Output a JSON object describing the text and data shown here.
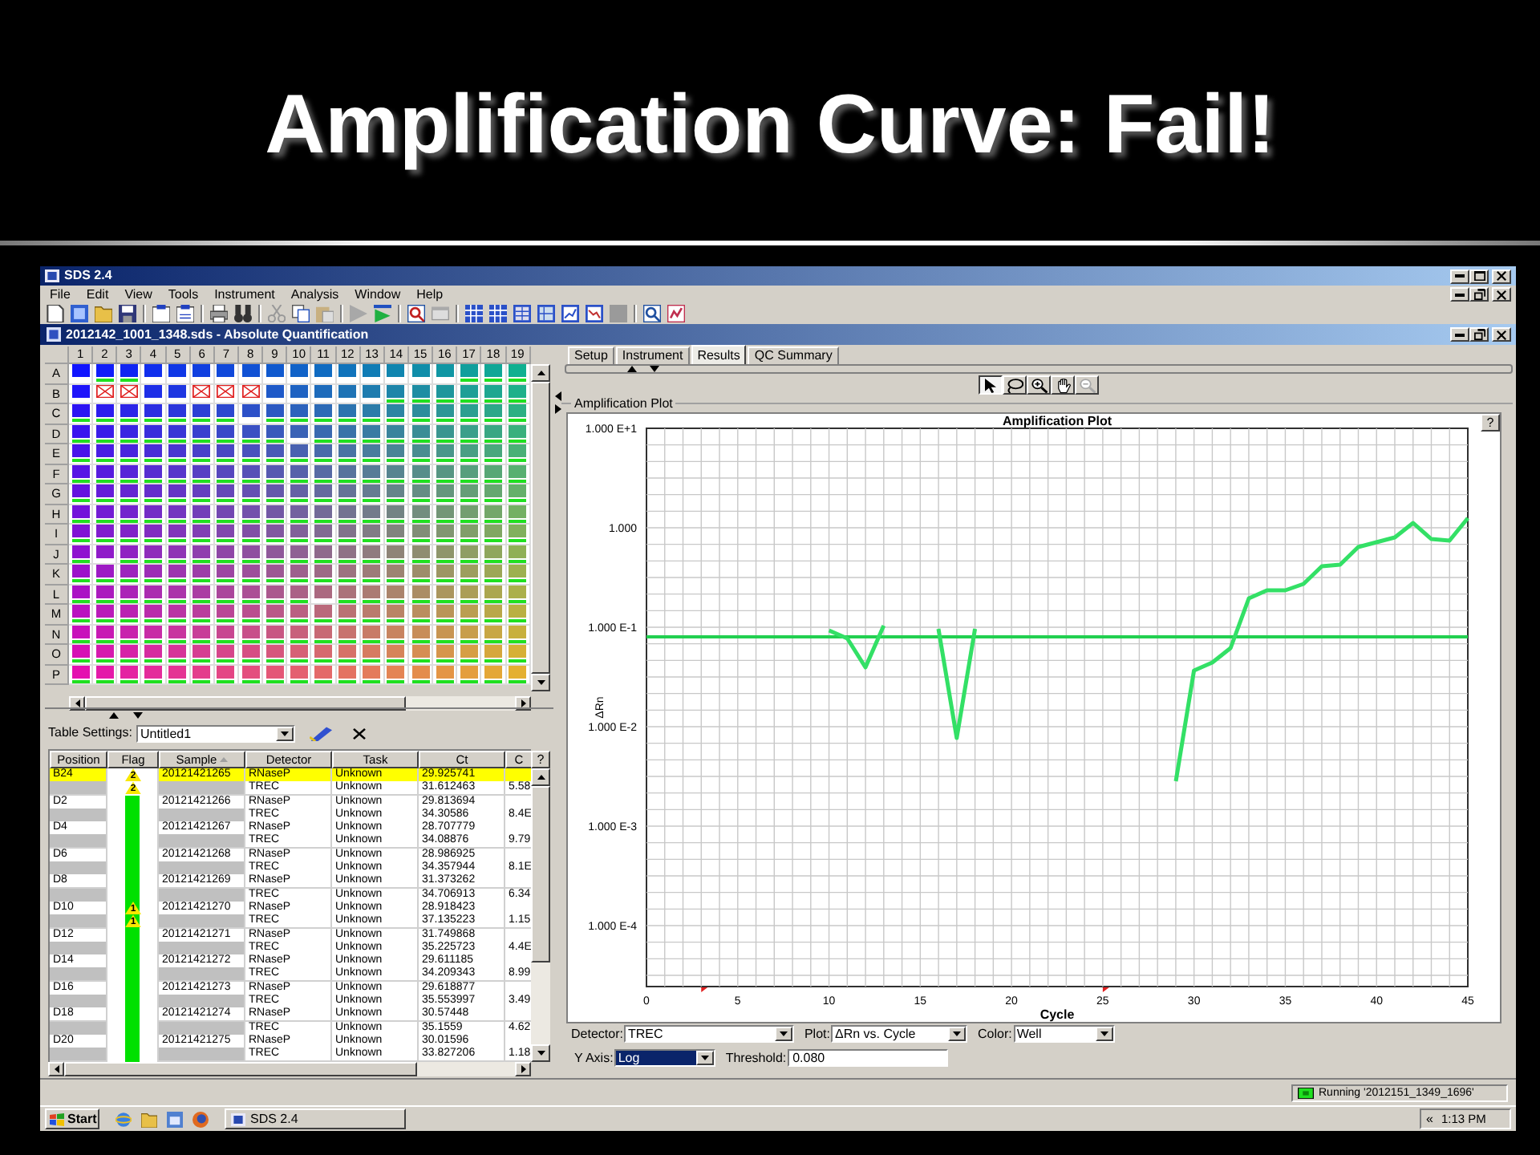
{
  "slide": {
    "title": "Amplification Curve: Fail!"
  },
  "window": {
    "title": "SDS 2.4"
  },
  "menu": [
    "File",
    "Edit",
    "View",
    "Tools",
    "Instrument",
    "Analysis",
    "Window",
    "Help"
  ],
  "document": {
    "title": "2012142_1001_1348.sds - Absolute Quantification"
  },
  "plate": {
    "columns": [
      "1",
      "2",
      "3",
      "4",
      "5",
      "6",
      "7",
      "8",
      "9",
      "10",
      "11",
      "12",
      "13",
      "14",
      "15",
      "16",
      "17",
      "18",
      "19"
    ],
    "rows": [
      {
        "label": "A",
        "wells": [
          {
            "omitted": false,
            "plotted": false
          },
          {
            "omitted": false,
            "plotted": true
          },
          {
            "omitted": false,
            "plotted": true
          },
          {
            "omitted": false,
            "plotted": false
          },
          {
            "omitted": false,
            "plotted": false
          },
          {
            "omitted": false,
            "plotted": false
          },
          {
            "omitted": false,
            "plotted": false
          },
          {
            "omitted": false,
            "plotted": false
          },
          {
            "omitted": false,
            "plotted": false
          },
          {
            "omitted": false,
            "plotted": false
          },
          {
            "omitted": false,
            "plotted": false
          },
          {
            "omitted": false,
            "plotted": false
          },
          {
            "omitted": false,
            "plotted": false
          },
          {
            "omitted": false,
            "plotted": false
          },
          {
            "omitted": false,
            "plotted": false
          },
          {
            "omitted": false,
            "plotted": false
          },
          {
            "omitted": false,
            "plotted": true
          },
          {
            "omitted": false,
            "plotted": true
          },
          {
            "omitted": false,
            "plotted": true
          }
        ]
      },
      {
        "label": "B",
        "wells": [
          {
            "omitted": false,
            "plotted": false
          },
          {
            "omitted": true,
            "plotted": false
          },
          {
            "omitted": true,
            "plotted": false
          },
          {
            "omitted": false,
            "plotted": false
          },
          {
            "omitted": false,
            "plotted": false
          },
          {
            "omitted": true,
            "plotted": false
          },
          {
            "omitted": true,
            "plotted": false
          },
          {
            "omitted": true,
            "plotted": false
          },
          {
            "omitted": false,
            "plotted": false
          },
          {
            "omitted": false,
            "plotted": false
          },
          {
            "omitted": false,
            "plotted": false
          },
          {
            "omitted": false,
            "plotted": false
          },
          {
            "omitted": false,
            "plotted": false
          },
          {
            "omitted": false,
            "plotted": true
          },
          {
            "omitted": false,
            "plotted": true
          },
          {
            "omitted": false,
            "plotted": true
          },
          {
            "omitted": false,
            "plotted": true
          },
          {
            "omitted": false,
            "plotted": true
          },
          {
            "omitted": false,
            "plotted": true
          }
        ]
      },
      {
        "label": "C",
        "wells": [
          {
            "omitted": false,
            "plotted": true
          },
          {
            "omitted": false,
            "plotted": true
          },
          {
            "omitted": false,
            "plotted": true
          },
          {
            "omitted": false,
            "plotted": true
          },
          {
            "omitted": false,
            "plotted": true
          },
          {
            "omitted": false,
            "plotted": true
          },
          {
            "omitted": false,
            "plotted": true
          },
          {
            "omitted": false,
            "plotted": false
          },
          {
            "omitted": false,
            "plotted": true
          },
          {
            "omitted": false,
            "plotted": true
          },
          {
            "omitted": false,
            "plotted": true
          },
          {
            "omitted": false,
            "plotted": true
          },
          {
            "omitted": false,
            "plotted": true
          },
          {
            "omitted": false,
            "plotted": true
          },
          {
            "omitted": false,
            "plotted": true
          },
          {
            "omitted": false,
            "plotted": true
          },
          {
            "omitted": false,
            "plotted": true
          },
          {
            "omitted": false,
            "plotted": true
          },
          {
            "omitted": false,
            "plotted": true
          }
        ]
      },
      {
        "label": "D",
        "wells": [
          {
            "omitted": false,
            "plotted": true
          },
          {
            "omitted": false,
            "plotted": true
          },
          {
            "omitted": false,
            "plotted": true
          },
          {
            "omitted": false,
            "plotted": true
          },
          {
            "omitted": false,
            "plotted": true
          },
          {
            "omitted": false,
            "plotted": true
          },
          {
            "omitted": false,
            "plotted": true
          },
          {
            "omitted": false,
            "plotted": true
          },
          {
            "omitted": false,
            "plotted": true
          },
          {
            "omitted": false,
            "plotted": false
          },
          {
            "omitted": false,
            "plotted": true
          },
          {
            "omitted": false,
            "plotted": true
          },
          {
            "omitted": false,
            "plotted": true
          },
          {
            "omitted": false,
            "plotted": true
          },
          {
            "omitted": false,
            "plotted": true
          },
          {
            "omitted": false,
            "plotted": true
          },
          {
            "omitted": false,
            "plotted": true
          },
          {
            "omitted": false,
            "plotted": true
          },
          {
            "omitted": false,
            "plotted": true
          }
        ]
      },
      {
        "label": "E",
        "wells": [
          {
            "omitted": false,
            "plotted": true
          },
          {
            "omitted": false,
            "plotted": true
          },
          {
            "omitted": false,
            "plotted": true
          },
          {
            "omitted": false,
            "plotted": true
          },
          {
            "omitted": false,
            "plotted": true
          },
          {
            "omitted": false,
            "plotted": true
          },
          {
            "omitted": false,
            "plotted": true
          },
          {
            "omitted": false,
            "plotted": true
          },
          {
            "omitted": false,
            "plotted": true
          },
          {
            "omitted": false,
            "plotted": true
          },
          {
            "omitted": false,
            "plotted": true
          },
          {
            "omitted": false,
            "plotted": true
          },
          {
            "omitted": false,
            "plotted": true
          },
          {
            "omitted": false,
            "plotted": true
          },
          {
            "omitted": false,
            "plotted": true
          },
          {
            "omitted": false,
            "plotted": true
          },
          {
            "omitted": false,
            "plotted": true
          },
          {
            "omitted": false,
            "plotted": true
          },
          {
            "omitted": false,
            "plotted": true
          }
        ]
      },
      {
        "label": "F",
        "wells": [
          {
            "omitted": false,
            "plotted": true
          },
          {
            "omitted": false,
            "plotted": true
          },
          {
            "omitted": false,
            "plotted": true
          },
          {
            "omitted": false,
            "plotted": true
          },
          {
            "omitted": false,
            "plotted": true
          },
          {
            "omitted": false,
            "plotted": true
          },
          {
            "omitted": false,
            "plotted": true
          },
          {
            "omitted": false,
            "plotted": true
          },
          {
            "omitted": false,
            "plotted": true
          },
          {
            "omitted": false,
            "plotted": true
          },
          {
            "omitted": false,
            "plotted": true
          },
          {
            "omitted": false,
            "plotted": true
          },
          {
            "omitted": false,
            "plotted": true
          },
          {
            "omitted": false,
            "plotted": true
          },
          {
            "omitted": false,
            "plotted": true
          },
          {
            "omitted": false,
            "plotted": true
          },
          {
            "omitted": false,
            "plotted": true
          },
          {
            "omitted": false,
            "plotted": true
          },
          {
            "omitted": false,
            "plotted": true
          }
        ]
      },
      {
        "label": "G",
        "wells": [
          {
            "omitted": false,
            "plotted": true
          },
          {
            "omitted": false,
            "plotted": true
          },
          {
            "omitted": false,
            "plotted": true
          },
          {
            "omitted": false,
            "plotted": true
          },
          {
            "omitted": false,
            "plotted": true
          },
          {
            "omitted": false,
            "plotted": true
          },
          {
            "omitted": false,
            "plotted": true
          },
          {
            "omitted": false,
            "plotted": true
          },
          {
            "omitted": false,
            "plotted": true
          },
          {
            "omitted": false,
            "plotted": true
          },
          {
            "omitted": false,
            "plotted": true
          },
          {
            "omitted": false,
            "plotted": true
          },
          {
            "omitted": false,
            "plotted": true
          },
          {
            "omitted": false,
            "plotted": true
          },
          {
            "omitted": false,
            "plotted": true
          },
          {
            "omitted": false,
            "plotted": true
          },
          {
            "omitted": false,
            "plotted": true
          },
          {
            "omitted": false,
            "plotted": true
          },
          {
            "omitted": false,
            "plotted": true
          }
        ]
      },
      {
        "label": "H",
        "wells": [
          {
            "omitted": false,
            "plotted": true
          },
          {
            "omitted": false,
            "plotted": true
          },
          {
            "omitted": false,
            "plotted": true
          },
          {
            "omitted": false,
            "plotted": true
          },
          {
            "omitted": false,
            "plotted": true
          },
          {
            "omitted": false,
            "plotted": true
          },
          {
            "omitted": false,
            "plotted": true
          },
          {
            "omitted": false,
            "plotted": true
          },
          {
            "omitted": false,
            "plotted": true
          },
          {
            "omitted": false,
            "plotted": true
          },
          {
            "omitted": false,
            "plotted": true
          },
          {
            "omitted": false,
            "plotted": true
          },
          {
            "omitted": false,
            "plotted": true
          },
          {
            "omitted": false,
            "plotted": true
          },
          {
            "omitted": false,
            "plotted": true
          },
          {
            "omitted": false,
            "plotted": true
          },
          {
            "omitted": false,
            "plotted": true
          },
          {
            "omitted": false,
            "plotted": true
          },
          {
            "omitted": false,
            "plotted": true
          }
        ]
      },
      {
        "label": "I",
        "wells": [
          {
            "omitted": false,
            "plotted": true
          },
          {
            "omitted": false,
            "plotted": true
          },
          {
            "omitted": false,
            "plotted": true
          },
          {
            "omitted": false,
            "plotted": true
          },
          {
            "omitted": false,
            "plotted": true
          },
          {
            "omitted": false,
            "plotted": true
          },
          {
            "omitted": false,
            "plotted": true
          },
          {
            "omitted": false,
            "plotted": true
          },
          {
            "omitted": false,
            "plotted": true
          },
          {
            "omitted": false,
            "plotted": true
          },
          {
            "omitted": false,
            "plotted": true
          },
          {
            "omitted": false,
            "plotted": true
          },
          {
            "omitted": false,
            "plotted": true
          },
          {
            "omitted": false,
            "plotted": true
          },
          {
            "omitted": false,
            "plotted": true
          },
          {
            "omitted": false,
            "plotted": true
          },
          {
            "omitted": false,
            "plotted": true
          },
          {
            "omitted": false,
            "plotted": true
          },
          {
            "omitted": false,
            "plotted": true
          }
        ]
      },
      {
        "label": "J",
        "wells": [
          {
            "omitted": false,
            "plotted": true
          },
          {
            "omitted": false,
            "plotted": false
          },
          {
            "omitted": false,
            "plotted": true
          },
          {
            "omitted": false,
            "plotted": true
          },
          {
            "omitted": false,
            "plotted": true
          },
          {
            "omitted": false,
            "plotted": true
          },
          {
            "omitted": false,
            "plotted": true
          },
          {
            "omitted": false,
            "plotted": true
          },
          {
            "omitted": false,
            "plotted": true
          },
          {
            "omitted": false,
            "plotted": true
          },
          {
            "omitted": false,
            "plotted": true
          },
          {
            "omitted": false,
            "plotted": true
          },
          {
            "omitted": false,
            "plotted": true
          },
          {
            "omitted": false,
            "plotted": true
          },
          {
            "omitted": false,
            "plotted": true
          },
          {
            "omitted": false,
            "plotted": true
          },
          {
            "omitted": false,
            "plotted": true
          },
          {
            "omitted": false,
            "plotted": true
          },
          {
            "omitted": false,
            "plotted": true
          }
        ]
      },
      {
        "label": "K",
        "wells": [
          {
            "omitted": false,
            "plotted": true
          },
          {
            "omitted": false,
            "plotted": true
          },
          {
            "omitted": false,
            "plotted": true
          },
          {
            "omitted": false,
            "plotted": true
          },
          {
            "omitted": false,
            "plotted": true
          },
          {
            "omitted": false,
            "plotted": true
          },
          {
            "omitted": false,
            "plotted": true
          },
          {
            "omitted": false,
            "plotted": true
          },
          {
            "omitted": false,
            "plotted": true
          },
          {
            "omitted": false,
            "plotted": true
          },
          {
            "omitted": false,
            "plotted": true
          },
          {
            "omitted": false,
            "plotted": true
          },
          {
            "omitted": false,
            "plotted": true
          },
          {
            "omitted": false,
            "plotted": true
          },
          {
            "omitted": false,
            "plotted": true
          },
          {
            "omitted": false,
            "plotted": true
          },
          {
            "omitted": false,
            "plotted": true
          },
          {
            "omitted": false,
            "plotted": true
          },
          {
            "omitted": false,
            "plotted": true
          }
        ]
      },
      {
        "label": "L",
        "wells": [
          {
            "omitted": false,
            "plotted": true
          },
          {
            "omitted": false,
            "plotted": true
          },
          {
            "omitted": false,
            "plotted": true
          },
          {
            "omitted": false,
            "plotted": true
          },
          {
            "omitted": false,
            "plotted": true
          },
          {
            "omitted": false,
            "plotted": true
          },
          {
            "omitted": false,
            "plotted": true
          },
          {
            "omitted": false,
            "plotted": true
          },
          {
            "omitted": false,
            "plotted": true
          },
          {
            "omitted": false,
            "plotted": true
          },
          {
            "omitted": false,
            "plotted": false
          },
          {
            "omitted": false,
            "plotted": true
          },
          {
            "omitted": false,
            "plotted": true
          },
          {
            "omitted": false,
            "plotted": true
          },
          {
            "omitted": false,
            "plotted": true
          },
          {
            "omitted": false,
            "plotted": true
          },
          {
            "omitted": false,
            "plotted": true
          },
          {
            "omitted": false,
            "plotted": true
          },
          {
            "omitted": false,
            "plotted": true
          }
        ]
      },
      {
        "label": "M",
        "wells": [
          {
            "omitted": false,
            "plotted": true
          },
          {
            "omitted": false,
            "plotted": true
          },
          {
            "omitted": false,
            "plotted": true
          },
          {
            "omitted": false,
            "plotted": true
          },
          {
            "omitted": false,
            "plotted": true
          },
          {
            "omitted": false,
            "plotted": true
          },
          {
            "omitted": false,
            "plotted": true
          },
          {
            "omitted": false,
            "plotted": true
          },
          {
            "omitted": false,
            "plotted": true
          },
          {
            "omitted": false,
            "plotted": true
          },
          {
            "omitted": false,
            "plotted": true
          },
          {
            "omitted": false,
            "plotted": true
          },
          {
            "omitted": false,
            "plotted": true
          },
          {
            "omitted": false,
            "plotted": true
          },
          {
            "omitted": false,
            "plotted": true
          },
          {
            "omitted": false,
            "plotted": true
          },
          {
            "omitted": false,
            "plotted": true
          },
          {
            "omitted": false,
            "plotted": true
          },
          {
            "omitted": false,
            "plotted": true
          }
        ]
      },
      {
        "label": "N",
        "wells": [
          {
            "omitted": false,
            "plotted": true
          },
          {
            "omitted": false,
            "plotted": true
          },
          {
            "omitted": false,
            "plotted": true
          },
          {
            "omitted": false,
            "plotted": true
          },
          {
            "omitted": false,
            "plotted": true
          },
          {
            "omitted": false,
            "plotted": true
          },
          {
            "omitted": false,
            "plotted": true
          },
          {
            "omitted": false,
            "plotted": true
          },
          {
            "omitted": false,
            "plotted": true
          },
          {
            "omitted": false,
            "plotted": true
          },
          {
            "omitted": false,
            "plotted": true
          },
          {
            "omitted": false,
            "plotted": true
          },
          {
            "omitted": false,
            "plotted": true
          },
          {
            "omitted": false,
            "plotted": true
          },
          {
            "omitted": false,
            "plotted": true
          },
          {
            "omitted": false,
            "plotted": true
          },
          {
            "omitted": false,
            "plotted": true
          },
          {
            "omitted": false,
            "plotted": true
          },
          {
            "omitted": false,
            "plotted": true
          }
        ]
      },
      {
        "label": "O",
        "wells": [
          {
            "omitted": false,
            "plotted": true
          },
          {
            "omitted": false,
            "plotted": true
          },
          {
            "omitted": false,
            "plotted": true
          },
          {
            "omitted": false,
            "plotted": true
          },
          {
            "omitted": false,
            "plotted": true
          },
          {
            "omitted": false,
            "plotted": true
          },
          {
            "omitted": false,
            "plotted": true
          },
          {
            "omitted": false,
            "plotted": true
          },
          {
            "omitted": false,
            "plotted": true
          },
          {
            "omitted": false,
            "plotted": true
          },
          {
            "omitted": false,
            "plotted": true
          },
          {
            "omitted": false,
            "plotted": true
          },
          {
            "omitted": false,
            "plotted": true
          },
          {
            "omitted": false,
            "plotted": true
          },
          {
            "omitted": false,
            "plotted": true
          },
          {
            "omitted": false,
            "plotted": true
          },
          {
            "omitted": false,
            "plotted": true
          },
          {
            "omitted": false,
            "plotted": true
          },
          {
            "omitted": false,
            "plotted": true
          }
        ]
      },
      {
        "label": "P",
        "wells": [
          {
            "omitted": false,
            "plotted": true
          },
          {
            "omitted": false,
            "plotted": true
          },
          {
            "omitted": false,
            "plotted": true
          },
          {
            "omitted": false,
            "plotted": true
          },
          {
            "omitted": false,
            "plotted": true
          },
          {
            "omitted": false,
            "plotted": true
          },
          {
            "omitted": false,
            "plotted": true
          },
          {
            "omitted": false,
            "plotted": true
          },
          {
            "omitted": false,
            "plotted": true
          },
          {
            "omitted": false,
            "plotted": true
          },
          {
            "omitted": false,
            "plotted": true
          },
          {
            "omitted": false,
            "plotted": true
          },
          {
            "omitted": false,
            "plotted": true
          },
          {
            "omitted": false,
            "plotted": true
          },
          {
            "omitted": false,
            "plotted": true
          },
          {
            "omitted": false,
            "plotted": true
          },
          {
            "omitted": false,
            "plotted": true
          },
          {
            "omitted": false,
            "plotted": true
          },
          {
            "omitted": false,
            "plotted": true
          }
        ]
      }
    ]
  },
  "table_settings": {
    "label": "Table Settings:",
    "value": "Untitled1"
  },
  "table": {
    "columns": [
      {
        "label": "Position",
        "sorted": false
      },
      {
        "label": "Flag",
        "sorted": false
      },
      {
        "label": "Sample",
        "sorted": true
      },
      {
        "label": "Detector",
        "sorted": false
      },
      {
        "label": "Task",
        "sorted": false
      },
      {
        "label": "Ct",
        "sorted": false
      },
      {
        "label": "C",
        "sorted": false
      }
    ],
    "help_button": "?",
    "rows": [
      {
        "selected": true,
        "position": "B24",
        "flagged": true,
        "flag_label": "2",
        "passed": false,
        "sample": "20121421265",
        "detector": "RNaseP",
        "task": "Unknown",
        "ct": "29.925741"
      },
      {
        "selected": false,
        "flagged": true,
        "flag_label": "2",
        "passed": false,
        "detector": "TREC",
        "task": "Unknown",
        "ct": "31.612463",
        "column_7": "5.58"
      },
      {
        "selected": false,
        "position": "D2",
        "flagged": false,
        "passed": true,
        "sample": "20121421266",
        "detector": "RNaseP",
        "task": "Unknown",
        "ct": "29.813694"
      },
      {
        "selected": false,
        "flagged": false,
        "passed": true,
        "detector": "TREC",
        "task": "Unknown",
        "ct": "34.30586",
        "column_7": "8.4E"
      },
      {
        "selected": false,
        "position": "D4",
        "flagged": false,
        "passed": true,
        "sample": "20121421267",
        "detector": "RNaseP",
        "task": "Unknown",
        "ct": "28.707779"
      },
      {
        "selected": false,
        "flagged": false,
        "passed": true,
        "detector": "TREC",
        "task": "Unknown",
        "ct": "34.08876",
        "column_7": "9.79"
      },
      {
        "selected": false,
        "position": "D6",
        "flagged": false,
        "passed": true,
        "sample": "20121421268",
        "detector": "RNaseP",
        "task": "Unknown",
        "ct": "28.986925"
      },
      {
        "selected": false,
        "flagged": false,
        "passed": true,
        "detector": "TREC",
        "task": "Unknown",
        "ct": "34.357944",
        "column_7": "8.1E"
      },
      {
        "selected": false,
        "position": "D8",
        "flagged": false,
        "passed": true,
        "sample": "20121421269",
        "detector": "RNaseP",
        "task": "Unknown",
        "ct": "31.373262"
      },
      {
        "selected": false,
        "flagged": false,
        "passed": true,
        "detector": "TREC",
        "task": "Unknown",
        "ct": "34.706913",
        "column_7": "6.34"
      },
      {
        "selected": false,
        "position": "D10",
        "flagged": true,
        "flag_label": "1",
        "passed": true,
        "sample": "20121421270",
        "detector": "RNaseP",
        "task": "Unknown",
        "ct": "28.918423"
      },
      {
        "selected": false,
        "flagged": true,
        "flag_label": "1",
        "passed": true,
        "detector": "TREC",
        "task": "Unknown",
        "ct": "37.135223",
        "column_7": "1.15"
      },
      {
        "selected": false,
        "position": "D12",
        "flagged": false,
        "passed": true,
        "sample": "20121421271",
        "detector": "RNaseP",
        "task": "Unknown",
        "ct": "31.749868"
      },
      {
        "selected": false,
        "flagged": false,
        "passed": true,
        "detector": "TREC",
        "task": "Unknown",
        "ct": "35.225723",
        "column_7": "4.4E"
      },
      {
        "selected": false,
        "position": "D14",
        "flagged": false,
        "passed": true,
        "sample": "20121421272",
        "detector": "RNaseP",
        "task": "Unknown",
        "ct": "29.611185"
      },
      {
        "selected": false,
        "flagged": false,
        "passed": true,
        "detector": "TREC",
        "task": "Unknown",
        "ct": "34.209343",
        "column_7": "8.99"
      },
      {
        "selected": false,
        "position": "D16",
        "flagged": false,
        "passed": true,
        "sample": "20121421273",
        "detector": "RNaseP",
        "task": "Unknown",
        "ct": "29.618877"
      },
      {
        "selected": false,
        "flagged": false,
        "passed": true,
        "detector": "TREC",
        "task": "Unknown",
        "ct": "35.553997",
        "column_7": "3.49"
      },
      {
        "selected": false,
        "position": "D18",
        "flagged": false,
        "passed": true,
        "sample": "20121421274",
        "detector": "RNaseP",
        "task": "Unknown",
        "ct": "30.57448"
      },
      {
        "selected": false,
        "flagged": false,
        "passed": true,
        "detector": "TREC",
        "task": "Unknown",
        "ct": "35.1559",
        "column_7": "4.62"
      },
      {
        "selected": false,
        "position": "D20",
        "flagged": false,
        "passed": true,
        "sample": "20121421275",
        "detector": "RNaseP",
        "task": "Unknown",
        "ct": "30.01596"
      },
      {
        "selected": false,
        "flagged": false,
        "passed": true,
        "detector": "TREC",
        "task": "Unknown",
        "ct": "33.827206",
        "column_7": "1.18"
      }
    ]
  },
  "tabs": [
    {
      "label": "Setup",
      "selected": false
    },
    {
      "label": "Instrument",
      "selected": false
    },
    {
      "label": "Results",
      "selected": true
    },
    {
      "label": "QC Summary",
      "selected": false
    }
  ],
  "plot_tools": [
    {
      "kind": "pointer",
      "selected": true,
      "disabled": false
    },
    {
      "kind": "lasso",
      "selected": false,
      "disabled": false
    },
    {
      "kind": "zoom_in",
      "selected": false,
      "disabled": false
    },
    {
      "kind": "hand",
      "selected": false,
      "disabled": false
    },
    {
      "kind": "zoom_out",
      "selected": false,
      "disabled": true
    }
  ],
  "plot_panel": {
    "label": "Amplification Plot",
    "help_button": "?",
    "chart": {
      "title": "Amplification Plot",
      "y_tick_labels": [
        "1.000 E+1",
        "1.000",
        "1.000 E-1",
        "1.000 E-2",
        "1.000 E-3",
        "1.000 E-4"
      ],
      "x_tick_labels": [
        "0",
        "5",
        "10",
        "15",
        "20",
        "25",
        "30",
        "35",
        "40",
        "45"
      ],
      "xlabel": "Cycle",
      "ylabel": "ΔRn"
    }
  },
  "plot_controls": [
    {
      "controls": [
        {
          "kind": "dropdown",
          "label": "Detector:",
          "value": "TREC",
          "highlighted": false
        },
        {
          "kind": "dropdown",
          "label": "Plot:",
          "value": "ΔRn vs. Cycle",
          "highlighted": false
        },
        {
          "kind": "dropdown",
          "label": "Color:",
          "value": "Well",
          "highlighted": false
        }
      ]
    },
    {
      "controls": [
        {
          "kind": "dropdown",
          "label": "Y Axis:",
          "value": "Log",
          "highlighted": true
        },
        {
          "kind": "text_input",
          "label": "Threshold:",
          "value": "0.080",
          "highlighted": false
        }
      ]
    }
  ],
  "status_bar": {
    "status": "Running '2012151_1349_1696'"
  },
  "taskbar": {
    "start": "Start",
    "task": "SDS 2.4",
    "tray_toggle": "«",
    "clock": "1:13 PM"
  }
}
